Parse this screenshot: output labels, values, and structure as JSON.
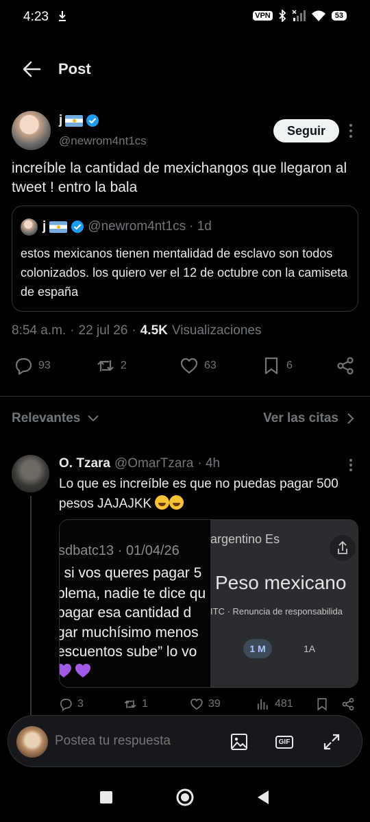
{
  "status_bar": {
    "time": "4:23",
    "vpn": "VPN",
    "battery": "53"
  },
  "header": {
    "title": "Post"
  },
  "post": {
    "author_name": "j",
    "author_handle": "@newrom4nt1cs",
    "follow_label": "Seguir",
    "text": "increíble la cantidad de mexichangos que llegaron al tweet ! entro la bala",
    "quote": {
      "author_name": "j",
      "author_handle": "@newrom4nt1cs",
      "time": "· 1d",
      "text": "estos mexicanos tienen mentalidad de esclavo son todos colonizados. los quiero ver el 12 de octubre con la camiseta de españa"
    },
    "time": "8:54 a.m.",
    "date": "22 jul 26",
    "views_count": "4.5K",
    "views_label": "Visualizaciones",
    "stats": {
      "replies": "93",
      "reposts": "2",
      "likes": "63",
      "bookmarks": "6"
    }
  },
  "sort": {
    "left_label": "Relevantes",
    "right_label": "Ver las citas"
  },
  "reply": {
    "author_name": "O. Tzara",
    "author_handle": "@OmarTzara",
    "time": "· 4h",
    "text": "Lo que es increíble es que no puedas pagar 500 pesos JAJAJKK",
    "media_left": {
      "meta": "sdbatc13 · 01/04/26",
      "lines": [
        "j si vos queres pagar 5",
        "blema, nadie te dice qu",
        " pagar esa cantidad d",
        "gar muchísimo menos",
        "escuentos sube” lo vo"
      ]
    },
    "media_right": {
      "top": "argentino Es",
      "big": "Peso mexicano",
      "small": "ITC · Renuncia de responsabilida",
      "chip_active": "1 M",
      "chip_other": "1A"
    },
    "stats": {
      "replies": "3",
      "reposts": "1",
      "likes": "39",
      "views": "481"
    }
  },
  "composer": {
    "placeholder": "Postea tu respuesta",
    "gif_label": "GIF"
  },
  "colors": {
    "accent": "#1d9bf0",
    "background": "#000000",
    "muted": "#71767b",
    "text": "#e7e9ea"
  }
}
